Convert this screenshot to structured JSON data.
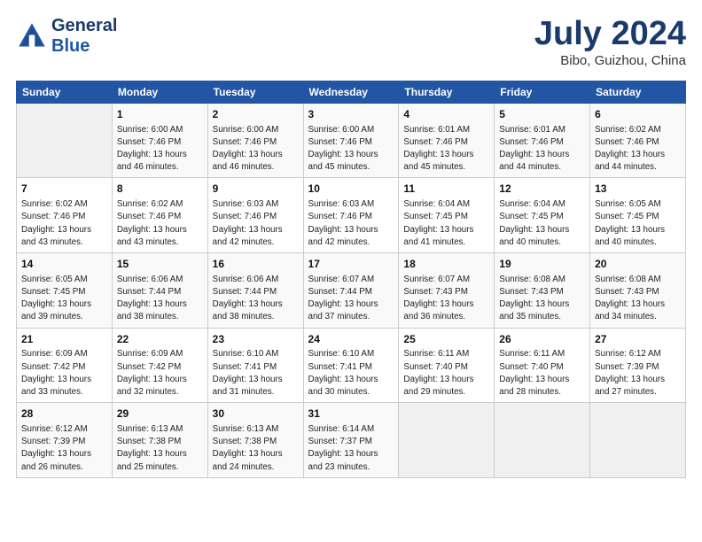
{
  "header": {
    "logo_line1": "General",
    "logo_line2": "Blue",
    "month": "July 2024",
    "location": "Bibo, Guizhou, China"
  },
  "weekdays": [
    "Sunday",
    "Monday",
    "Tuesday",
    "Wednesday",
    "Thursday",
    "Friday",
    "Saturday"
  ],
  "weeks": [
    [
      {
        "day": "",
        "info": ""
      },
      {
        "day": "1",
        "info": "Sunrise: 6:00 AM\nSunset: 7:46 PM\nDaylight: 13 hours\nand 46 minutes."
      },
      {
        "day": "2",
        "info": "Sunrise: 6:00 AM\nSunset: 7:46 PM\nDaylight: 13 hours\nand 46 minutes."
      },
      {
        "day": "3",
        "info": "Sunrise: 6:00 AM\nSunset: 7:46 PM\nDaylight: 13 hours\nand 45 minutes."
      },
      {
        "day": "4",
        "info": "Sunrise: 6:01 AM\nSunset: 7:46 PM\nDaylight: 13 hours\nand 45 minutes."
      },
      {
        "day": "5",
        "info": "Sunrise: 6:01 AM\nSunset: 7:46 PM\nDaylight: 13 hours\nand 44 minutes."
      },
      {
        "day": "6",
        "info": "Sunrise: 6:02 AM\nSunset: 7:46 PM\nDaylight: 13 hours\nand 44 minutes."
      }
    ],
    [
      {
        "day": "7",
        "info": "Sunrise: 6:02 AM\nSunset: 7:46 PM\nDaylight: 13 hours\nand 43 minutes."
      },
      {
        "day": "8",
        "info": "Sunrise: 6:02 AM\nSunset: 7:46 PM\nDaylight: 13 hours\nand 43 minutes."
      },
      {
        "day": "9",
        "info": "Sunrise: 6:03 AM\nSunset: 7:46 PM\nDaylight: 13 hours\nand 42 minutes."
      },
      {
        "day": "10",
        "info": "Sunrise: 6:03 AM\nSunset: 7:46 PM\nDaylight: 13 hours\nand 42 minutes."
      },
      {
        "day": "11",
        "info": "Sunrise: 6:04 AM\nSunset: 7:45 PM\nDaylight: 13 hours\nand 41 minutes."
      },
      {
        "day": "12",
        "info": "Sunrise: 6:04 AM\nSunset: 7:45 PM\nDaylight: 13 hours\nand 40 minutes."
      },
      {
        "day": "13",
        "info": "Sunrise: 6:05 AM\nSunset: 7:45 PM\nDaylight: 13 hours\nand 40 minutes."
      }
    ],
    [
      {
        "day": "14",
        "info": "Sunrise: 6:05 AM\nSunset: 7:45 PM\nDaylight: 13 hours\nand 39 minutes."
      },
      {
        "day": "15",
        "info": "Sunrise: 6:06 AM\nSunset: 7:44 PM\nDaylight: 13 hours\nand 38 minutes."
      },
      {
        "day": "16",
        "info": "Sunrise: 6:06 AM\nSunset: 7:44 PM\nDaylight: 13 hours\nand 38 minutes."
      },
      {
        "day": "17",
        "info": "Sunrise: 6:07 AM\nSunset: 7:44 PM\nDaylight: 13 hours\nand 37 minutes."
      },
      {
        "day": "18",
        "info": "Sunrise: 6:07 AM\nSunset: 7:43 PM\nDaylight: 13 hours\nand 36 minutes."
      },
      {
        "day": "19",
        "info": "Sunrise: 6:08 AM\nSunset: 7:43 PM\nDaylight: 13 hours\nand 35 minutes."
      },
      {
        "day": "20",
        "info": "Sunrise: 6:08 AM\nSunset: 7:43 PM\nDaylight: 13 hours\nand 34 minutes."
      }
    ],
    [
      {
        "day": "21",
        "info": "Sunrise: 6:09 AM\nSunset: 7:42 PM\nDaylight: 13 hours\nand 33 minutes."
      },
      {
        "day": "22",
        "info": "Sunrise: 6:09 AM\nSunset: 7:42 PM\nDaylight: 13 hours\nand 32 minutes."
      },
      {
        "day": "23",
        "info": "Sunrise: 6:10 AM\nSunset: 7:41 PM\nDaylight: 13 hours\nand 31 minutes."
      },
      {
        "day": "24",
        "info": "Sunrise: 6:10 AM\nSunset: 7:41 PM\nDaylight: 13 hours\nand 30 minutes."
      },
      {
        "day": "25",
        "info": "Sunrise: 6:11 AM\nSunset: 7:40 PM\nDaylight: 13 hours\nand 29 minutes."
      },
      {
        "day": "26",
        "info": "Sunrise: 6:11 AM\nSunset: 7:40 PM\nDaylight: 13 hours\nand 28 minutes."
      },
      {
        "day": "27",
        "info": "Sunrise: 6:12 AM\nSunset: 7:39 PM\nDaylight: 13 hours\nand 27 minutes."
      }
    ],
    [
      {
        "day": "28",
        "info": "Sunrise: 6:12 AM\nSunset: 7:39 PM\nDaylight: 13 hours\nand 26 minutes."
      },
      {
        "day": "29",
        "info": "Sunrise: 6:13 AM\nSunset: 7:38 PM\nDaylight: 13 hours\nand 25 minutes."
      },
      {
        "day": "30",
        "info": "Sunrise: 6:13 AM\nSunset: 7:38 PM\nDaylight: 13 hours\nand 24 minutes."
      },
      {
        "day": "31",
        "info": "Sunrise: 6:14 AM\nSunset: 7:37 PM\nDaylight: 13 hours\nand 23 minutes."
      },
      {
        "day": "",
        "info": ""
      },
      {
        "day": "",
        "info": ""
      },
      {
        "day": "",
        "info": ""
      }
    ]
  ]
}
